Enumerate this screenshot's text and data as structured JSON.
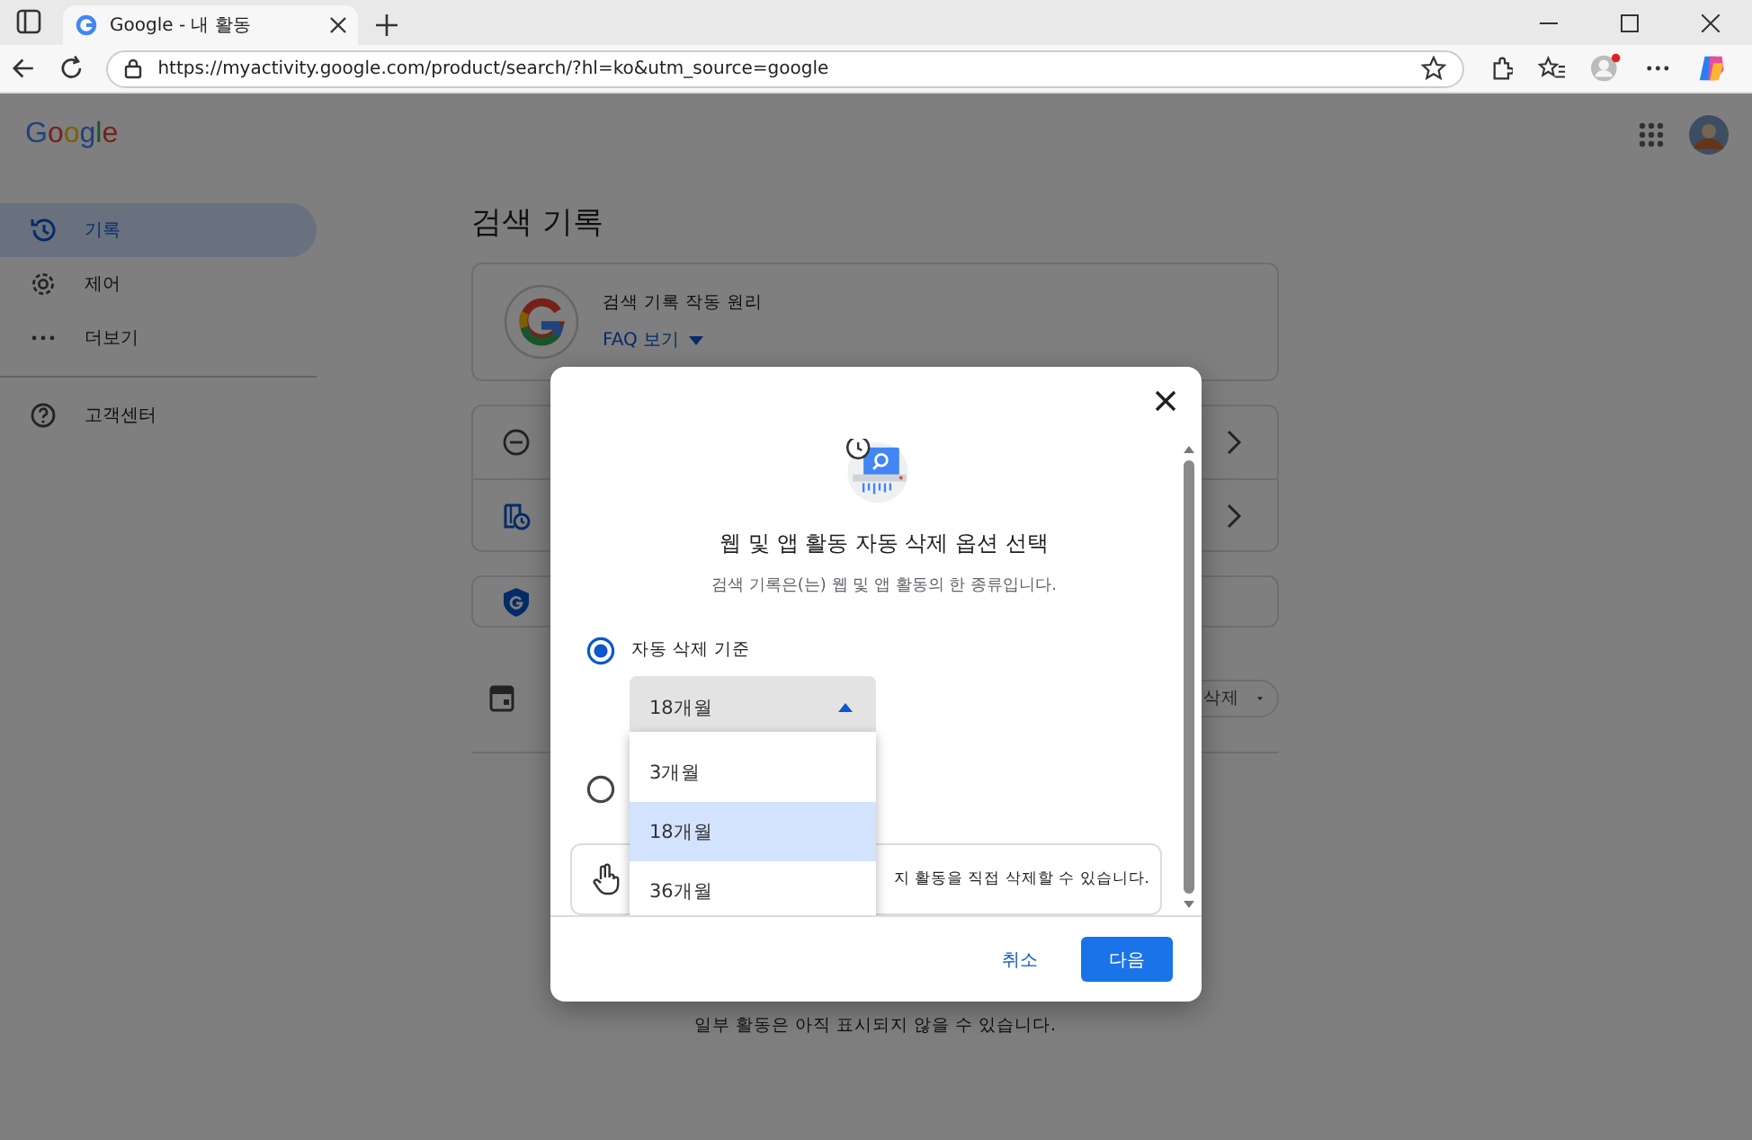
{
  "browser": {
    "tab_title": "Google - 내 활동",
    "address": "https://myactivity.google.com/product/search/?hl=ko&utm_source=google"
  },
  "header": {
    "logo": "Google"
  },
  "sidebar": {
    "items": [
      {
        "label": "기록",
        "kind": "history",
        "selected": true
      },
      {
        "label": "제어",
        "kind": "gear",
        "selected": false
      },
      {
        "label": "더보기",
        "kind": "dots",
        "selected": false
      }
    ],
    "help": {
      "label": "고객센터"
    }
  },
  "page": {
    "title": "검색 기록",
    "info_card": {
      "title": "검색 기록 작동 원리",
      "link": "FAQ 보기"
    },
    "delete_button": "삭제",
    "footer_note": "일부 활동은 아직 표시되지 않을 수 있습니다."
  },
  "dialog": {
    "title": "웹 및 앱 활동 자동 삭제 옵션 선택",
    "subtitle": "검색 기록은(는) 웹 및 앱 활동의 한 종류입니다.",
    "options": [
      {
        "label": "자동 삭제 기준",
        "selected": true
      },
      {
        "selected": false
      }
    ],
    "select": {
      "value": "18개월",
      "expanded": true
    },
    "menu": [
      {
        "label": "3개월",
        "selected": false
      },
      {
        "label": "18개월",
        "selected": true
      },
      {
        "label": "36개월",
        "selected": false
      }
    ],
    "info": "지 활동을 직접 삭제할 수 있습니다.",
    "cancel": "취소",
    "next": "다음"
  }
}
